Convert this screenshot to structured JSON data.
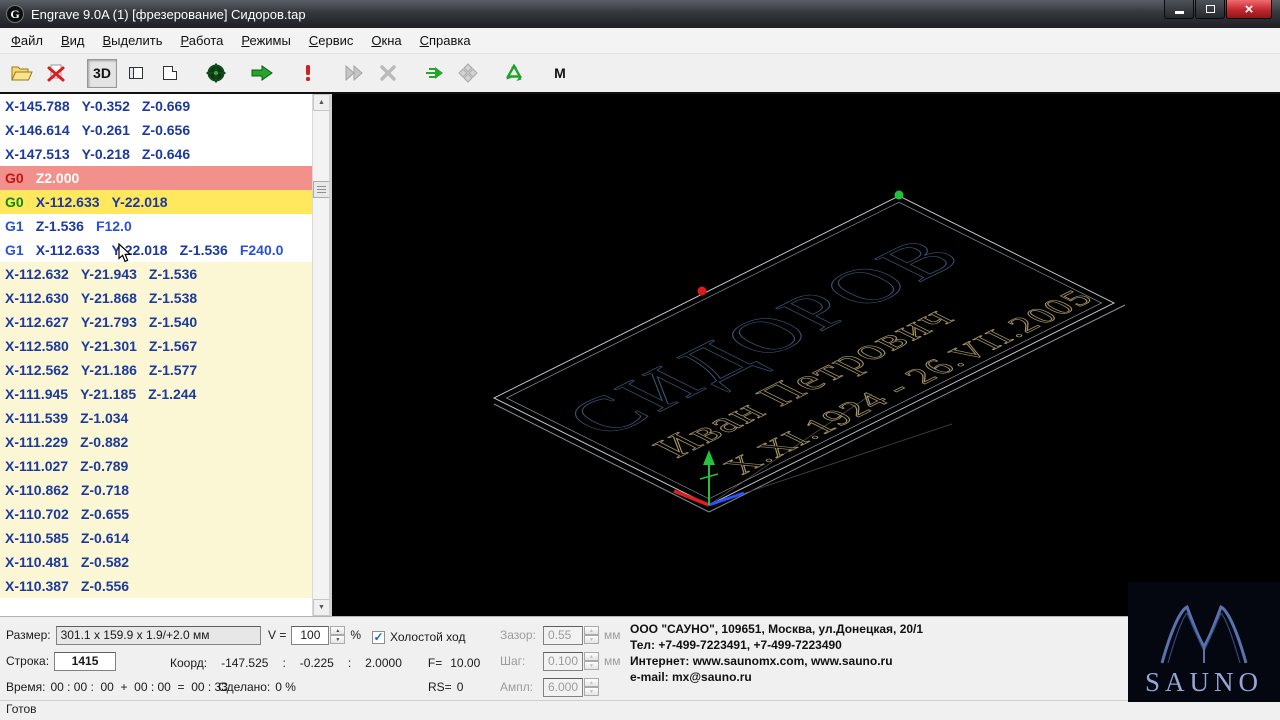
{
  "window": {
    "title": "Engrave 9.0A (1) [фрезерование] Сидоров.tap",
    "icon_letter": "G"
  },
  "menu": [
    "Файл",
    "Вид",
    "Выделить",
    "Работа",
    "Режимы",
    "Сервис",
    "Окна",
    "Справка"
  ],
  "toolbar": [
    {
      "name": "open-file",
      "icon": "open-folder-icon"
    },
    {
      "name": "delete-file",
      "icon": "delete-file-icon"
    },
    {
      "name": "view-3d",
      "icon": "cube-3d-icon",
      "label": "3D",
      "pressed": true,
      "gap": true
    },
    {
      "name": "view-front",
      "icon": "view-front-icon"
    },
    {
      "name": "view-top",
      "icon": "view-top-icon"
    },
    {
      "name": "center-origin",
      "icon": "target-icon",
      "gap": true
    },
    {
      "name": "run",
      "icon": "run-arrow-icon",
      "gap": true
    },
    {
      "name": "attention",
      "icon": "exclamation-icon",
      "gap": true
    },
    {
      "name": "fast-run",
      "icon": "fast-forward-icon",
      "disabled": true,
      "gap": true
    },
    {
      "name": "cancel",
      "icon": "cancel-x-icon",
      "disabled": true
    },
    {
      "name": "step-run",
      "icon": "step-arrow-icon",
      "gap": true
    },
    {
      "name": "grid",
      "icon": "grid-diamond-icon",
      "disabled": true
    },
    {
      "name": "optimize",
      "icon": "recycle-icon",
      "gap": true
    },
    {
      "name": "macro-m",
      "icon": "letter-m-icon",
      "label": "M",
      "gap": true
    }
  ],
  "gcode": [
    {
      "bg": "w",
      "toks": [
        [
          "X-145.788",
          "c"
        ],
        [
          "Y-0.352",
          "c"
        ],
        [
          "Z-0.669",
          "c"
        ]
      ]
    },
    {
      "bg": "w",
      "toks": [
        [
          "X-146.614",
          "c"
        ],
        [
          "Y-0.261",
          "c"
        ],
        [
          "Z-0.656",
          "c"
        ]
      ]
    },
    {
      "bg": "w",
      "toks": [
        [
          "X-147.513",
          "c"
        ],
        [
          "Y-0.218",
          "c"
        ],
        [
          "Z-0.646",
          "c"
        ]
      ]
    },
    {
      "bg": "p",
      "toks": [
        [
          "G0",
          "g0"
        ],
        [
          "Z2.000",
          "zl"
        ]
      ]
    },
    {
      "bg": "y",
      "toks": [
        [
          "G0",
          "g0g"
        ],
        [
          "X-112.633",
          "c"
        ],
        [
          "Y-22.018",
          "c"
        ]
      ]
    },
    {
      "bg": "w",
      "toks": [
        [
          "G1",
          "g1"
        ],
        [
          "Z-1.536",
          "c"
        ],
        [
          "F12.0",
          "f"
        ]
      ]
    },
    {
      "bg": "w",
      "toks": [
        [
          "G1",
          "g1"
        ],
        [
          "X-112.633",
          "c"
        ],
        [
          "Y-22.018",
          "c"
        ],
        [
          "Z-1.536",
          "c"
        ],
        [
          "F240.0",
          "f"
        ]
      ]
    },
    {
      "bg": "cr",
      "toks": [
        [
          "X-112.632",
          "c"
        ],
        [
          "Y-21.943",
          "c"
        ],
        [
          "Z-1.536",
          "c"
        ]
      ]
    },
    {
      "bg": "cr",
      "toks": [
        [
          "X-112.630",
          "c"
        ],
        [
          "Y-21.868",
          "c"
        ],
        [
          "Z-1.538",
          "c"
        ]
      ]
    },
    {
      "bg": "cr",
      "toks": [
        [
          "X-112.627",
          "c"
        ],
        [
          "Y-21.793",
          "c"
        ],
        [
          "Z-1.540",
          "c"
        ]
      ]
    },
    {
      "bg": "cr",
      "toks": [
        [
          "X-112.580",
          "c"
        ],
        [
          "Y-21.301",
          "c"
        ],
        [
          "Z-1.567",
          "c"
        ]
      ]
    },
    {
      "bg": "cr",
      "toks": [
        [
          "X-112.562",
          "c"
        ],
        [
          "Y-21.186",
          "c"
        ],
        [
          "Z-1.577",
          "c"
        ]
      ]
    },
    {
      "bg": "cr",
      "toks": [
        [
          "X-111.945",
          "c"
        ],
        [
          "Y-21.185",
          "c"
        ],
        [
          "Z-1.244",
          "c"
        ]
      ]
    },
    {
      "bg": "cr",
      "toks": [
        [
          "X-111.539",
          "c"
        ],
        [
          "Z-1.034",
          "c"
        ]
      ]
    },
    {
      "bg": "cr",
      "toks": [
        [
          "X-111.229",
          "c"
        ],
        [
          "Z-0.882",
          "c"
        ]
      ]
    },
    {
      "bg": "cr",
      "toks": [
        [
          "X-111.027",
          "c"
        ],
        [
          "Z-0.789",
          "c"
        ]
      ]
    },
    {
      "bg": "cr",
      "toks": [
        [
          "X-110.862",
          "c"
        ],
        [
          "Z-0.718",
          "c"
        ]
      ]
    },
    {
      "bg": "cr",
      "toks": [
        [
          "X-110.702",
          "c"
        ],
        [
          "Z-0.655",
          "c"
        ]
      ]
    },
    {
      "bg": "cr",
      "toks": [
        [
          "X-110.585",
          "c"
        ],
        [
          "Z-0.614",
          "c"
        ]
      ]
    },
    {
      "bg": "cr",
      "toks": [
        [
          "X-110.481",
          "c"
        ],
        [
          "Z-0.582",
          "c"
        ]
      ]
    },
    {
      "bg": "cr",
      "toks": [
        [
          "X-110.387",
          "c"
        ],
        [
          "Z-0.556",
          "c"
        ]
      ]
    }
  ],
  "viewport": {
    "engraving": {
      "title": "СИДОРОВ",
      "name": "Иван Петрович",
      "dates": "X.XI.1924 - 26.VII.2005"
    }
  },
  "panel": {
    "size_label": "Размер:",
    "size_value": "301.1 x 159.9 x 1.9/+2.0 мм",
    "v_label": "V =",
    "v_value": "100",
    "percent_label": "%",
    "idle_label": "Холостой ход",
    "gap_label": "Зазор:",
    "gap_value": "0.55",
    "gap_unit": "мм",
    "line_label": "Строка:",
    "line_value": "1415",
    "coord_label": "Коорд:",
    "coord_x": "-147.525",
    "coord_sep": ":",
    "coord_y": "-0.225",
    "coord_z": "2.0000",
    "feed_label": "F=",
    "feed_value": "10.00",
    "step_label": "Шаг:",
    "step_value": "0.100",
    "step_unit": "мм",
    "time_label": "Время:",
    "time_value": "00 : 00 :  00  +  00 : 00  =  00 : 33",
    "done_label": "Сделано:",
    "done_value": "0 %",
    "rs_label": "RS=",
    "rs_value": "0",
    "amp_label": "Ампл:",
    "amp_value": "6.000"
  },
  "company": {
    "line1": "ООО \"САУНО\", 109651, Москва, ул.Донецкая, 20/1",
    "line2": "Тел: +7-499-7223491, +7-499-7223490",
    "line3": "Интернет: www.saunomx.com, www.sauno.ru",
    "line4": "e-mail: mx@sauno.ru"
  },
  "logo": {
    "text": "SAUNO"
  },
  "statusbar": {
    "text": "Готов"
  },
  "colors": {
    "selection_yellow": "#ffe75e",
    "rapid_pink": "#f2918c",
    "block_cream": "#fbf7d5",
    "gcode_coord": "#1c3a9e",
    "gcode_g1": "#2a50d8",
    "gcode_g0_red": "#c41414",
    "gcode_g0_green": "#0c8a0c",
    "viewport_bg": "#000000",
    "engraving_title": "#34506e",
    "engraving_text": "#a39263",
    "logo_blue": "#5873ae",
    "marker_green": "#22c23a",
    "marker_red": "#e01818",
    "axis_blue": "#2a52ff"
  }
}
